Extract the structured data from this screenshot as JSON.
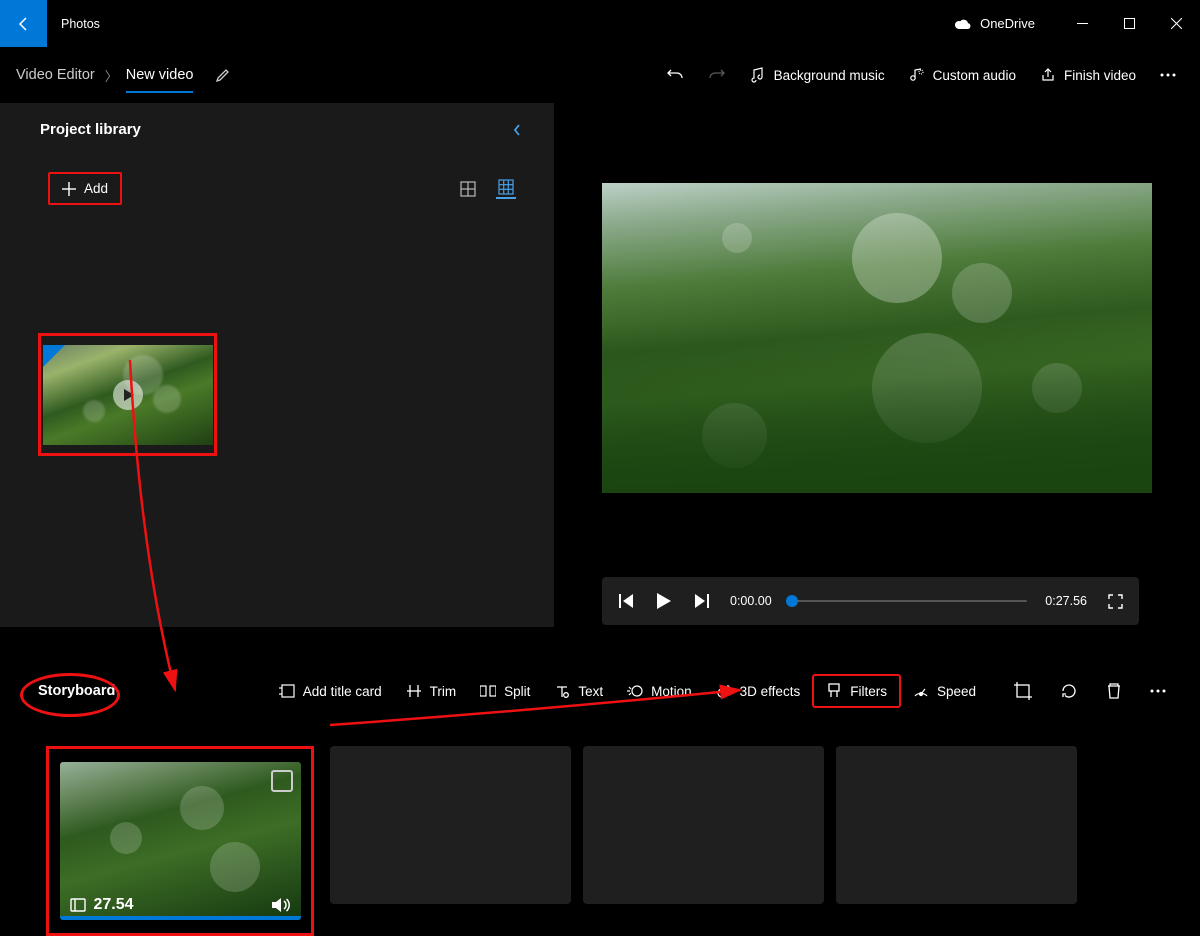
{
  "titlebar": {
    "app_name": "Photos",
    "onedrive_label": "OneDrive"
  },
  "toolbar": {
    "breadcrumb_root": "Video Editor",
    "project_name": "New video",
    "undo_icon": "undo-icon",
    "redo_icon": "redo-icon",
    "bg_music_label": "Background music",
    "custom_audio_label": "Custom audio",
    "finish_label": "Finish video"
  },
  "library": {
    "title": "Project library",
    "add_label": "Add"
  },
  "player": {
    "current_time": "0:00.00",
    "total_time": "0:27.56"
  },
  "storyboard": {
    "title": "Storyboard",
    "buttons": {
      "title_card": "Add title card",
      "trim": "Trim",
      "split": "Split",
      "text": "Text",
      "motion": "Motion",
      "effects3d": "3D effects",
      "filters": "Filters",
      "speed": "Speed"
    },
    "clip_duration": "27.54"
  }
}
